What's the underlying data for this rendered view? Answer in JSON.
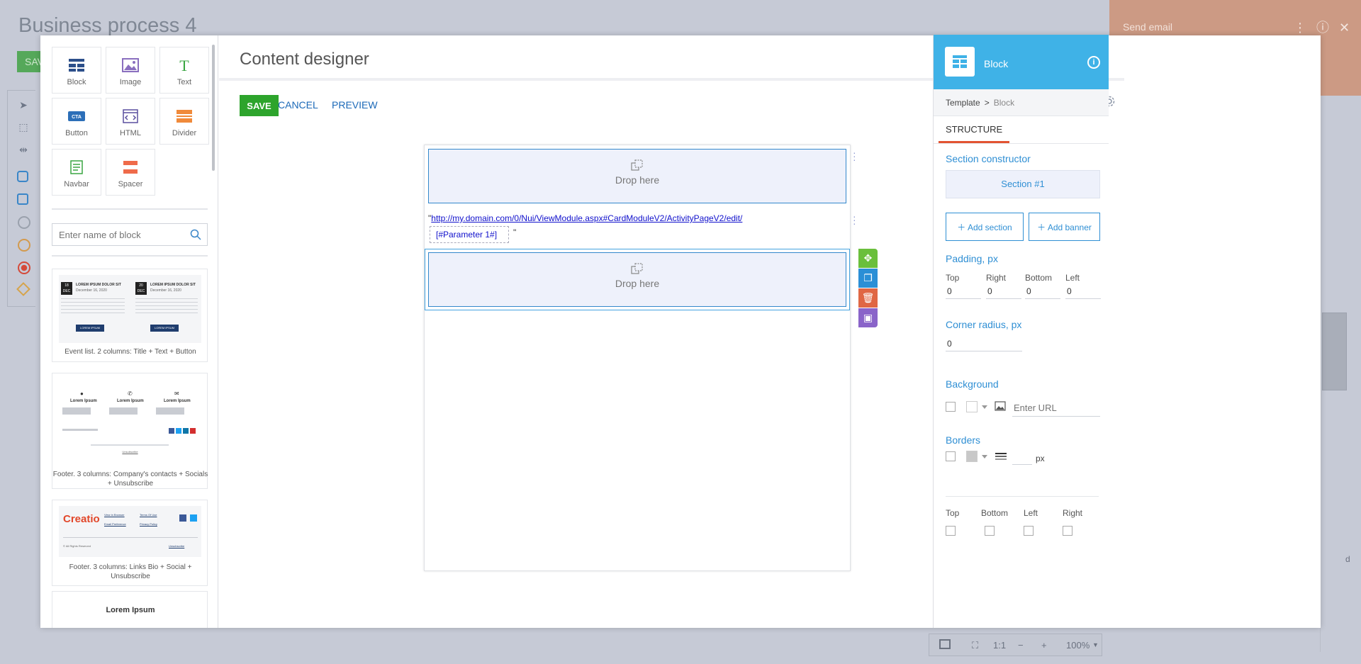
{
  "background": {
    "page_title": "Business process 4",
    "save_label": "SAV",
    "element_panel_title": "Send email",
    "right_letter": "d",
    "zoom": {
      "ratio": "1:1",
      "minus": "−",
      "plus": "+",
      "level": "100%"
    }
  },
  "palette": {
    "items": [
      {
        "label": "Block",
        "icon": "block-icon"
      },
      {
        "label": "Image",
        "icon": "image-icon"
      },
      {
        "label": "Text",
        "icon": "text-icon"
      },
      {
        "label": "Button",
        "icon": "button-icon"
      },
      {
        "label": "HTML",
        "icon": "html-icon"
      },
      {
        "label": "Divider",
        "icon": "divider-icon"
      },
      {
        "label": "Navbar",
        "icon": "navbar-icon"
      },
      {
        "label": "Spacer",
        "icon": "spacer-icon"
      }
    ],
    "search_placeholder": "Enter name of block",
    "templates": [
      {
        "caption": "Event list. 2 columns: Title + Text + Button"
      },
      {
        "caption": "Footer. 3 columns: Company's contacts + Socials + Unsubscribe"
      },
      {
        "caption": "Footer. 3 columns: Links Bio + Social + Unsubscribe"
      },
      {
        "caption": "Lorem Ipsum"
      }
    ],
    "thumb_text": {
      "lorem_title": "LOREM IPSUM DOLOR SIT",
      "lorem_date": "December 16, 2020",
      "lorem_button": "LOREM IPSUM",
      "day1": "18",
      "day2": "20",
      "month": "DEC",
      "lorem_ipsum": "Lorem Ipsum",
      "creatio": "Creatio",
      "view_browser": "View in Browser",
      "email_pref": "Email Preference",
      "terms": "Terms Of Use",
      "privacy": "Privacy Policy",
      "rights": "© All Rights Reserved",
      "unsubscribe": "Unsubscribe"
    }
  },
  "designer": {
    "title": "Content designer",
    "save_label": "SAVE",
    "cancel_label": "CANCEL",
    "preview_label": "PREVIEW",
    "drop_label": "Drop here",
    "link_open_quote": "\"",
    "link_text": "http://my.domain.com/0/Nui/ViewModule.aspx#CardModuleV2/ActivityPageV2/edit/",
    "param_text": "[#Parameter 1#]",
    "link_close_quote": "\""
  },
  "inspector": {
    "title": "Block",
    "breadcrumb": [
      "Template",
      "Block"
    ],
    "tab": "STRUCTURE",
    "section_constructor": "Section constructor",
    "section_item": "Section #1",
    "add_section": "Add section",
    "add_banner": "Add banner",
    "padding_title": "Padding, px",
    "padding": [
      {
        "label": "Top",
        "value": "0"
      },
      {
        "label": "Right",
        "value": "0"
      },
      {
        "label": "Bottom",
        "value": "0"
      },
      {
        "label": "Left",
        "value": "0"
      }
    ],
    "corner_title": "Corner radius, px",
    "corner_value": "0",
    "background_title": "Background",
    "url_placeholder": "Enter URL",
    "borders_title": "Borders",
    "border_unit": "px",
    "border_sides": [
      "Top",
      "Bottom",
      "Left",
      "Right"
    ]
  },
  "colors": {
    "accent": "#3fb2e7",
    "save_green": "#2da42c",
    "link_blue": "#1b69b8",
    "move_green": "#6abf3c",
    "copy_blue": "#2b8fd6",
    "delete_red": "#e06744",
    "save_purple": "#8a64c9"
  }
}
